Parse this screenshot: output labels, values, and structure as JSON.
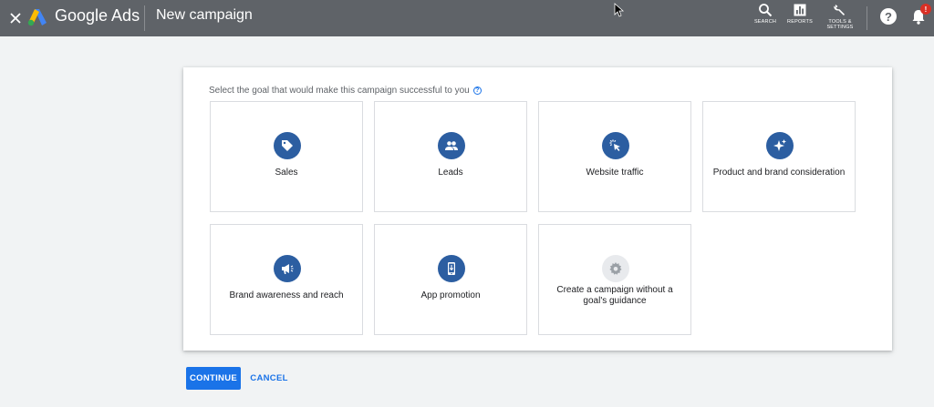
{
  "header": {
    "brand": "Google Ads",
    "title": "New campaign",
    "tools": [
      {
        "label": "SEARCH",
        "icon": "search-icon"
      },
      {
        "label": "REPORTS",
        "icon": "reports-icon"
      },
      {
        "label": "TOOLS & SETTINGS",
        "icon": "wrench-icon"
      }
    ],
    "help_glyph": "?",
    "notification_count": "!"
  },
  "main": {
    "prompt": "Select the goal that would make this campaign successful to you",
    "goals": [
      {
        "label": "Sales",
        "icon": "tag-icon"
      },
      {
        "label": "Leads",
        "icon": "people-icon"
      },
      {
        "label": "Website traffic",
        "icon": "cursor-click-icon"
      },
      {
        "label": "Product and brand consideration",
        "icon": "sparkle-icon"
      },
      {
        "label": "Brand awareness and reach",
        "icon": "megaphone-icon"
      },
      {
        "label": "App promotion",
        "icon": "phone-download-icon"
      },
      {
        "label": "Create a campaign without a goal's guidance",
        "icon": "gear-icon"
      }
    ]
  },
  "actions": {
    "continue_label": "CONTINUE",
    "cancel_label": "CANCEL"
  },
  "colors": {
    "header_bg": "#5f6368",
    "accent": "#1a73e8",
    "goal_icon_bg": "#2c5ea1"
  }
}
